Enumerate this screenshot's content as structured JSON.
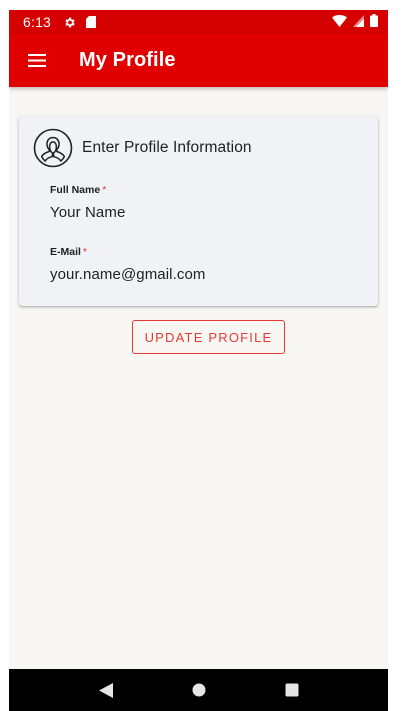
{
  "status_bar": {
    "time": "6:13",
    "left_icons": [
      "settings-gear-icon",
      "sd-card-icon"
    ],
    "right_icons": [
      "wifi-icon",
      "signal-icon",
      "battery-icon"
    ]
  },
  "app_bar": {
    "menu_icon": "hamburger-menu-icon",
    "title": "My Profile"
  },
  "card": {
    "icon": "user-profile-icon",
    "title": "Enter Profile Information",
    "fields": [
      {
        "label": "Full Name",
        "required_mark": "*",
        "value": "Your Name"
      },
      {
        "label": "E-Mail",
        "required_mark": "*",
        "value": "your.name@gmail.com"
      }
    ]
  },
  "update_button": {
    "label": "UPDATE PROFILE"
  },
  "nav_bar": {
    "buttons": [
      "back-triangle-icon",
      "home-circle-icon",
      "recents-square-icon"
    ]
  },
  "colors": {
    "status_bar": "#d50000",
    "app_bar": "#e00000",
    "accent": "#e53935",
    "background": "#f8f7f3",
    "card": "#f1f2f6"
  }
}
